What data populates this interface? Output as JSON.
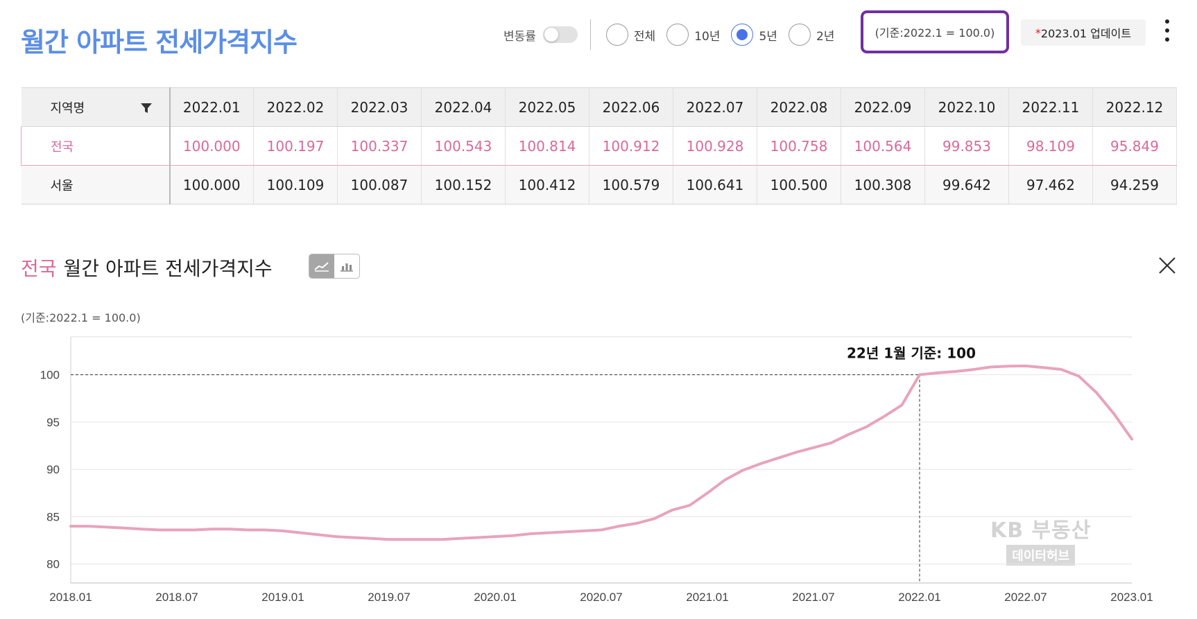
{
  "header": {
    "title": "월간 아파트 전세가격지수",
    "toggle_label": "변동률",
    "toggle_on": false,
    "periods": [
      {
        "label": "전체",
        "checked": false
      },
      {
        "label": "10년",
        "checked": false
      },
      {
        "label": "5년",
        "checked": true
      },
      {
        "label": "2년",
        "checked": false
      }
    ],
    "basis_note": "(기준:2022.1 = 100.0)",
    "update_star": "*",
    "update_text": "2023.01 업데이트",
    "menu_icon": "kebab-menu-icon"
  },
  "table": {
    "region_header": "지역명",
    "filter_icon": "filter-icon",
    "months": [
      "2022.01",
      "2022.02",
      "2022.03",
      "2022.04",
      "2022.05",
      "2022.06",
      "2022.07",
      "2022.08",
      "2022.09",
      "2022.10",
      "2022.11",
      "2022.12"
    ],
    "rows": [
      {
        "region": "전국",
        "values": [
          "100.000",
          "100.197",
          "100.337",
          "100.543",
          "100.814",
          "100.912",
          "100.928",
          "100.758",
          "100.564",
          "99.853",
          "98.109",
          "95.849"
        ]
      },
      {
        "region": "서울",
        "values": [
          "100.000",
          "100.109",
          "100.087",
          "100.152",
          "100.412",
          "100.579",
          "100.641",
          "100.500",
          "100.308",
          "99.642",
          "97.462",
          "94.259"
        ]
      }
    ]
  },
  "chart_section": {
    "region": "전국",
    "title": "월간 아파트 전세가격지수",
    "basis_note": "(기준:2022.1 = 100.0)",
    "annotation": "22년 1월 기준: 100",
    "watermark_top": "KB 부동산",
    "watermark_bottom": "데이터허브",
    "icons": [
      "line-chart-icon",
      "bar-chart-icon",
      "close-icon"
    ]
  },
  "colors": {
    "title": "#5b8ee6",
    "accent_pink": "#d9699a",
    "line": "#e8a3bd",
    "highlight_border": "#7030a0",
    "radio": "#4a73e8"
  },
  "chart_data": {
    "type": "line",
    "title": "",
    "xlabel": "",
    "ylabel": "",
    "ylim": [
      78,
      104
    ],
    "yticks": [
      80,
      85,
      90,
      95,
      100
    ],
    "xticks": [
      "2018.01",
      "2018.07",
      "2019.01",
      "2019.07",
      "2020.01",
      "2020.07",
      "2021.01",
      "2021.07",
      "2022.01",
      "2022.07",
      "2023.01"
    ],
    "grid": true,
    "reference": {
      "x": "2022.01",
      "y": 100,
      "label": "22년 1월 기준: 100"
    },
    "series": [
      {
        "name": "전국",
        "x": [
          "2018.01",
          "2018.02",
          "2018.03",
          "2018.04",
          "2018.05",
          "2018.06",
          "2018.07",
          "2018.08",
          "2018.09",
          "2018.10",
          "2018.11",
          "2018.12",
          "2019.01",
          "2019.02",
          "2019.03",
          "2019.04",
          "2019.05",
          "2019.06",
          "2019.07",
          "2019.08",
          "2019.09",
          "2019.10",
          "2019.11",
          "2019.12",
          "2020.01",
          "2020.02",
          "2020.03",
          "2020.04",
          "2020.05",
          "2020.06",
          "2020.07",
          "2020.08",
          "2020.09",
          "2020.10",
          "2020.11",
          "2020.12",
          "2021.01",
          "2021.02",
          "2021.03",
          "2021.04",
          "2021.05",
          "2021.06",
          "2021.07",
          "2021.08",
          "2021.09",
          "2021.10",
          "2021.11",
          "2021.12",
          "2022.01",
          "2022.02",
          "2022.03",
          "2022.04",
          "2022.05",
          "2022.06",
          "2022.07",
          "2022.08",
          "2022.09",
          "2022.10",
          "2022.11",
          "2022.12",
          "2023.01"
        ],
        "values": [
          84.0,
          84.0,
          83.9,
          83.8,
          83.7,
          83.6,
          83.6,
          83.6,
          83.7,
          83.7,
          83.6,
          83.6,
          83.5,
          83.3,
          83.1,
          82.9,
          82.8,
          82.7,
          82.6,
          82.6,
          82.6,
          82.6,
          82.7,
          82.8,
          82.9,
          83.0,
          83.2,
          83.3,
          83.4,
          83.5,
          83.6,
          84.0,
          84.3,
          84.8,
          85.7,
          86.2,
          87.5,
          88.9,
          89.9,
          90.6,
          91.2,
          91.8,
          92.3,
          92.8,
          93.7,
          94.5,
          95.6,
          96.8,
          100.0,
          100.197,
          100.337,
          100.543,
          100.814,
          100.912,
          100.928,
          100.758,
          100.564,
          99.853,
          98.109,
          95.849,
          93.2
        ]
      }
    ]
  }
}
